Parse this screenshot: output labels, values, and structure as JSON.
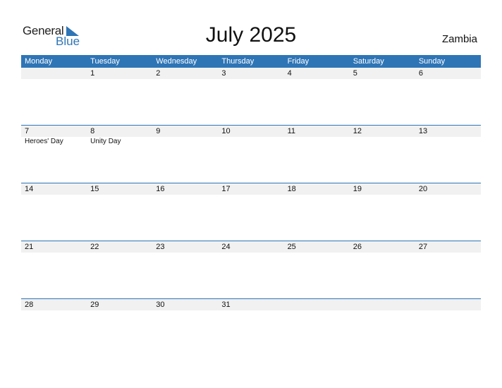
{
  "logo": {
    "general": "General",
    "blue": "Blue"
  },
  "title": "July 2025",
  "country": "Zambia",
  "colors": {
    "accent": "#2e75b6",
    "row_bg": "#f1f1f1"
  },
  "weekdays": [
    "Monday",
    "Tuesday",
    "Wednesday",
    "Thursday",
    "Friday",
    "Saturday",
    "Sunday"
  ],
  "weeks": [
    {
      "days": [
        "",
        "1",
        "2",
        "3",
        "4",
        "5",
        "6"
      ],
      "events": [
        "",
        "",
        "",
        "",
        "",
        "",
        ""
      ]
    },
    {
      "days": [
        "7",
        "8",
        "9",
        "10",
        "11",
        "12",
        "13"
      ],
      "events": [
        "Heroes' Day",
        "Unity Day",
        "",
        "",
        "",
        "",
        ""
      ]
    },
    {
      "days": [
        "14",
        "15",
        "16",
        "17",
        "18",
        "19",
        "20"
      ],
      "events": [
        "",
        "",
        "",
        "",
        "",
        "",
        ""
      ]
    },
    {
      "days": [
        "21",
        "22",
        "23",
        "24",
        "25",
        "26",
        "27"
      ],
      "events": [
        "",
        "",
        "",
        "",
        "",
        "",
        ""
      ]
    },
    {
      "days": [
        "28",
        "29",
        "30",
        "31",
        "",
        "",
        ""
      ],
      "events": [
        "",
        "",
        "",
        "",
        "",
        "",
        ""
      ]
    }
  ]
}
